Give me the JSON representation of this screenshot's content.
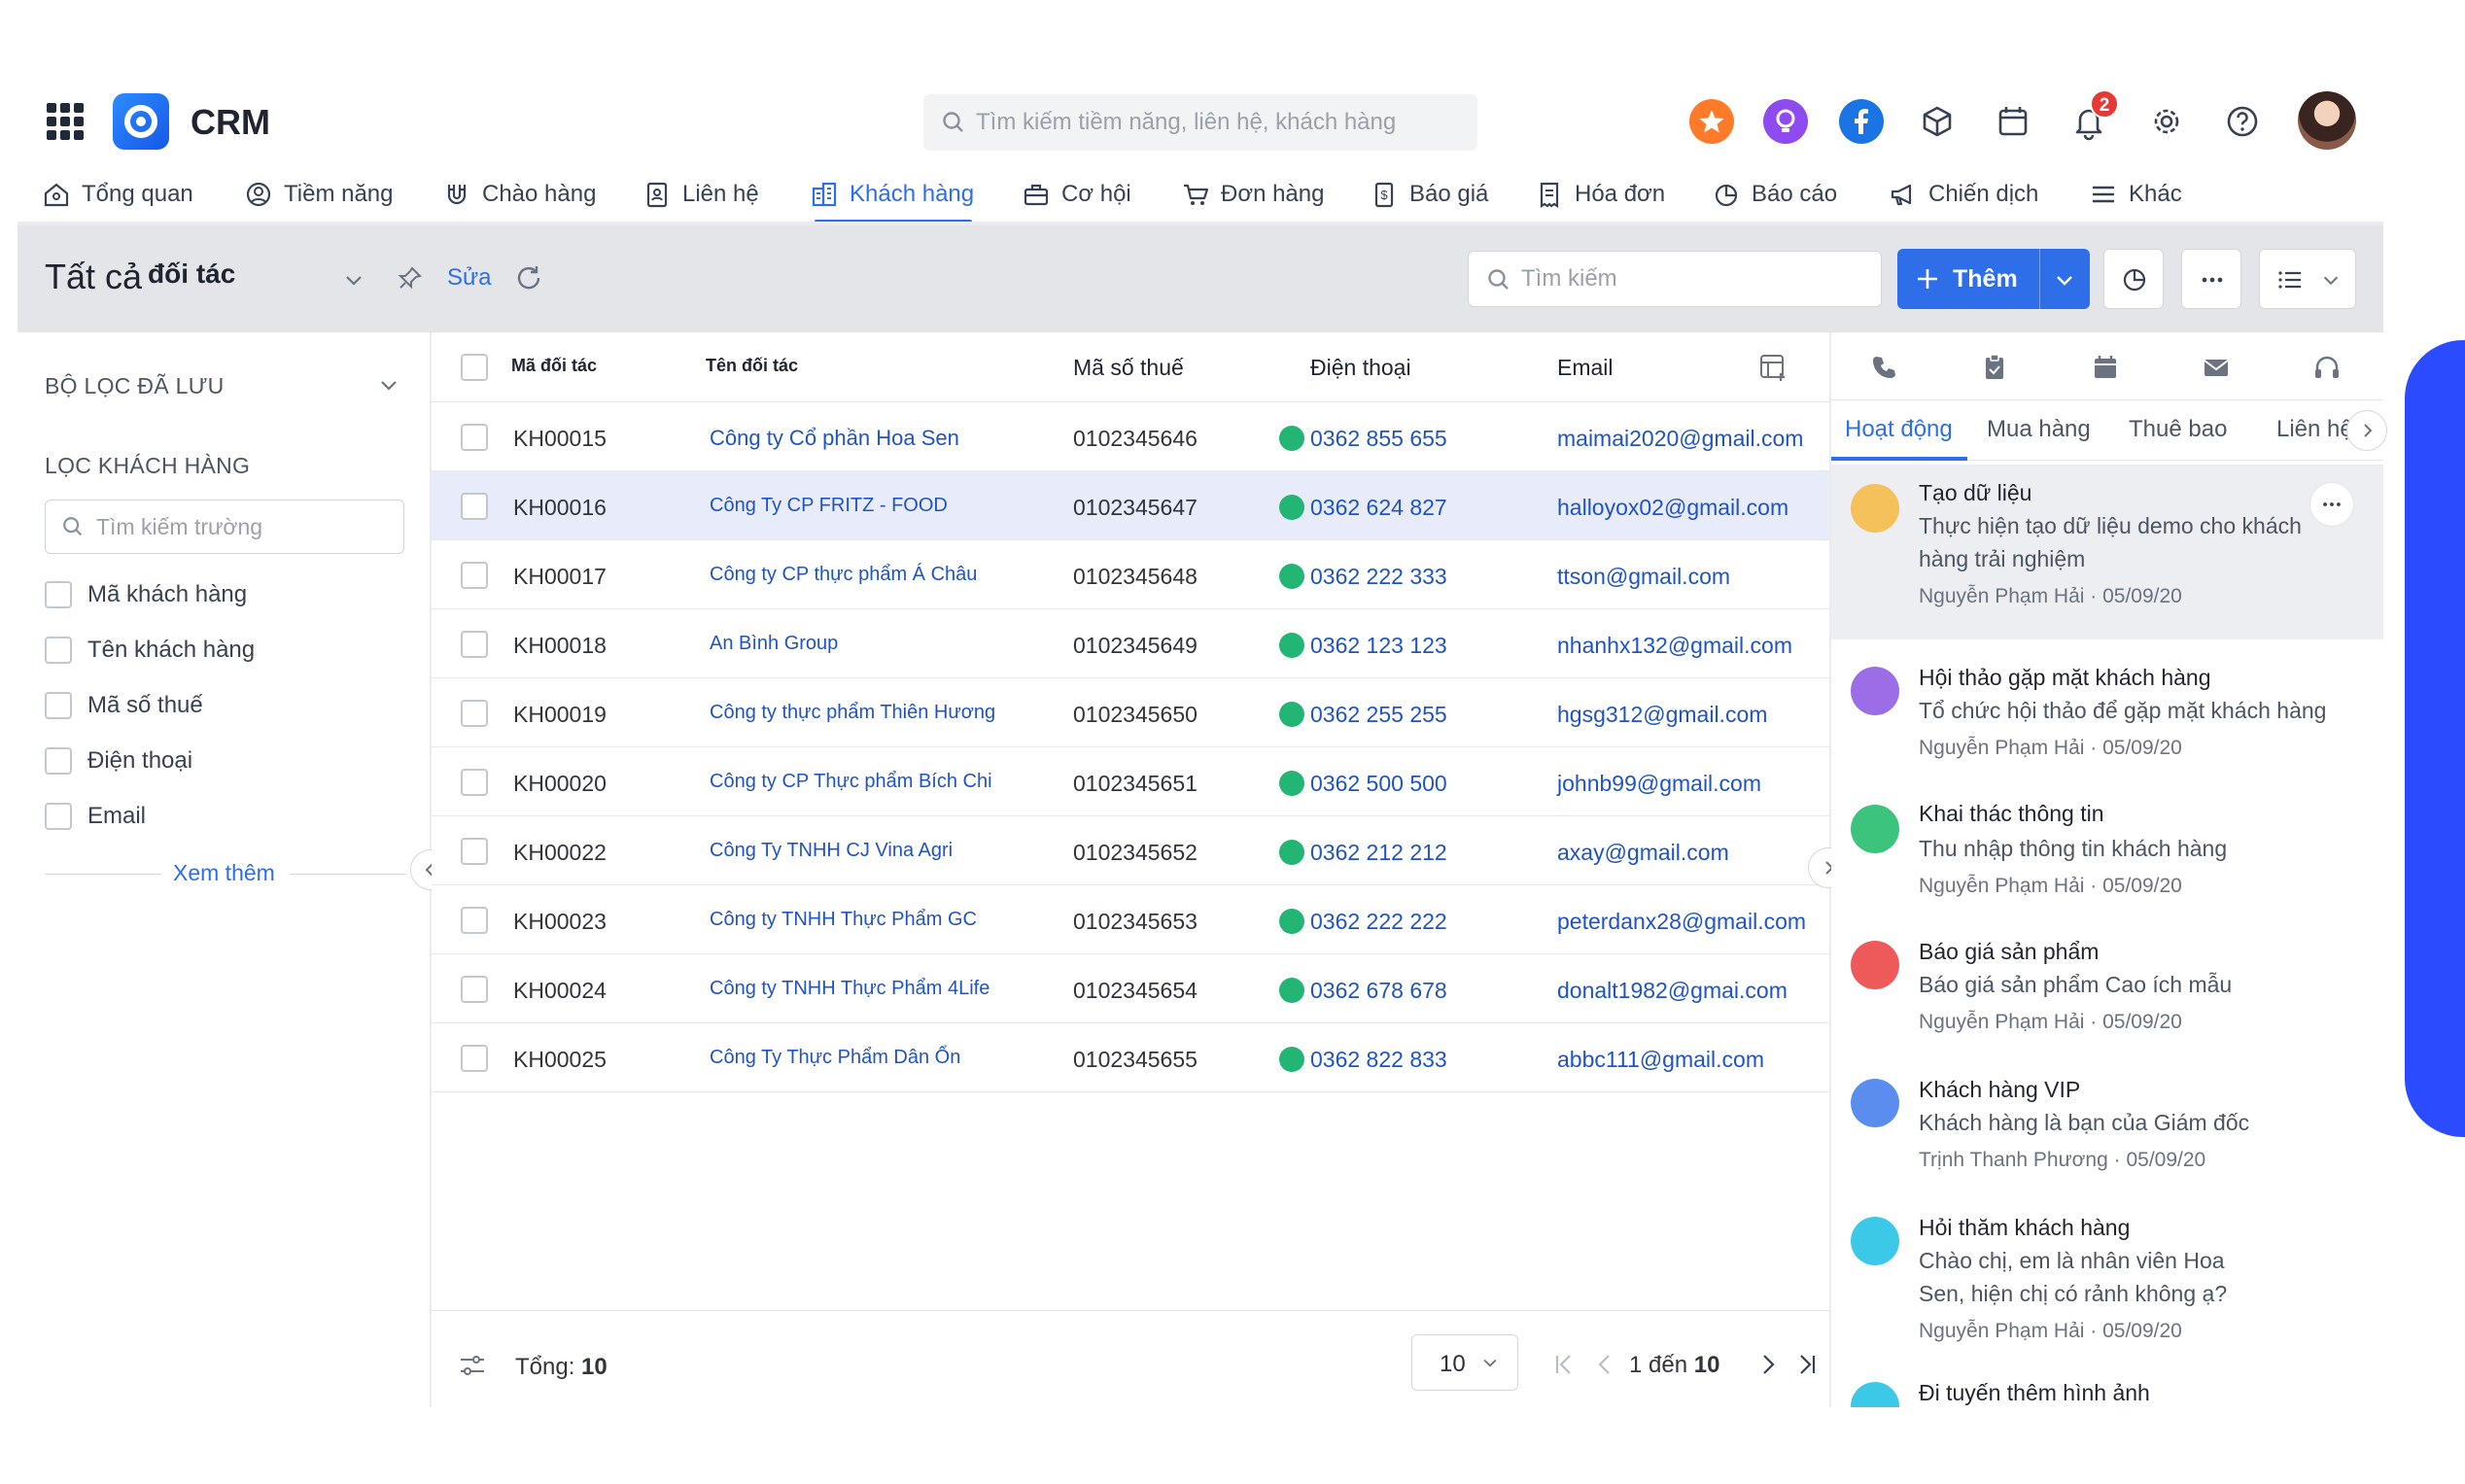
{
  "app": {
    "name": "CRM",
    "search_placeholder": "Tìm kiếm tiềm năng, liên hệ, khách hàng",
    "notification_count": "2"
  },
  "nav": [
    {
      "label": "Tổng quan",
      "icon": "home-icon"
    },
    {
      "label": "Tiềm năng",
      "icon": "lead-icon"
    },
    {
      "label": "Chào hàng",
      "icon": "magnet-icon"
    },
    {
      "label": "Liên hệ",
      "icon": "contact-icon"
    },
    {
      "label": "Khách hàng",
      "icon": "building-icon",
      "active": true
    },
    {
      "label": "Cơ hội",
      "icon": "briefcase-icon"
    },
    {
      "label": "Đơn hàng",
      "icon": "cart-icon"
    },
    {
      "label": "Báo giá",
      "icon": "quote-icon"
    },
    {
      "label": "Hóa đơn",
      "icon": "invoice-icon"
    },
    {
      "label": "Báo cáo",
      "icon": "report-icon"
    },
    {
      "label": "Chiến dịch",
      "icon": "megaphone-icon"
    },
    {
      "label": "Khác",
      "icon": "menu-icon"
    }
  ],
  "toolbar": {
    "view_title": "Tất cả",
    "view_subtitle": "đối tác",
    "edit_label": "Sửa",
    "search_placeholder": "Tìm kiếm",
    "add_label": "Thêm"
  },
  "filters": {
    "saved_title": "BỘ LỌC ĐÃ LƯU",
    "filter_title": "LỌC KHÁCH HÀNG",
    "field_search_placeholder": "Tìm kiếm trường",
    "fields": [
      "Mã khách hàng",
      "Tên khách hàng",
      "Mã số thuế",
      "Điện thoại",
      "Email"
    ],
    "see_more": "Xem thêm"
  },
  "table": {
    "headers": {
      "code": "Mã đối tác",
      "name": "Tên đối tác",
      "tax": "Mã số thuế",
      "phone": "Điện thoại",
      "email": "Email"
    },
    "rows": [
      {
        "code": "KH00015",
        "name": "Công ty Cổ phần Hoa Sen",
        "tax": "0102345646",
        "phone": "0362 855 655",
        "email": "maimai2020@gmail.com"
      },
      {
        "code": "KH00016",
        "name": "Công Ty CP FRITZ - FOOD",
        "tax": "0102345647",
        "phone": "0362 624 827",
        "email": "halloyox02@gmail.com"
      },
      {
        "code": "KH00017",
        "name": "Công ty CP thực phẩm Á Châu",
        "tax": "0102345648",
        "phone": "0362 222 333",
        "email": "ttson@gmail.com"
      },
      {
        "code": "KH00018",
        "name": "An Bình Group",
        "tax": "0102345649",
        "phone": "0362 123 123",
        "email": "nhanhx132@gmail.com"
      },
      {
        "code": "KH00019",
        "name": "Công ty thực phẩm Thiên Hương",
        "tax": "0102345650",
        "phone": "0362 255 255",
        "email": "hgsg312@gmail.com"
      },
      {
        "code": "KH00020",
        "name": "Công ty CP Thực phẩm Bích Chi",
        "tax": "0102345651",
        "phone": "0362 500 500",
        "email": "johnb99@gmail.com"
      },
      {
        "code": "KH00022",
        "name": "Công Ty TNHH CJ Vina Agri",
        "tax": "0102345652",
        "phone": "0362 212 212",
        "email": "axay@gmail.com"
      },
      {
        "code": "KH00023",
        "name": "Công ty TNHH Thực Phẩm GC",
        "tax": "0102345653",
        "phone": "0362 222 222",
        "email": "peterdanx28@gmail.com"
      },
      {
        "code": "KH00024",
        "name": "Công ty TNHH Thực Phẩm 4Life",
        "tax": "0102345654",
        "phone": "0362 678 678",
        "email": "donalt1982@gmai.com"
      },
      {
        "code": "KH00025",
        "name": "Công Ty Thực Phẩm Dân Ổn",
        "tax": "0102345655",
        "phone": "0362 822 833",
        "email": "abbc111@gmail.com"
      }
    ],
    "total_label": "Tổng:",
    "total_value": "10",
    "page_size": "10",
    "range_prefix": "1 đến",
    "range_end": "10"
  },
  "activity": {
    "tabs": [
      "Hoạt động",
      "Mua hàng",
      "Thuê bao",
      "Liên hệ"
    ],
    "items": [
      {
        "title": "Tạo dữ liệu",
        "desc": "Thực hiện tạo dữ liệu demo cho khách hàng trải nghiệm",
        "author": "Nguyễn Phạm Hải",
        "date": "05/09/20",
        "color": "#f5c15a"
      },
      {
        "title": "Hội thảo gặp mặt khách hàng",
        "desc": "Tổ chức hội thảo để gặp mặt khách hàng",
        "author": "Nguyễn Phạm Hải",
        "date": "05/09/20",
        "color": "#9b6ee8"
      },
      {
        "title": "Khai thác thông tin",
        "desc": "Thu nhập thông tin khách hàng",
        "author": "Nguyễn Phạm Hải",
        "date": "05/09/20",
        "color": "#3cc47c"
      },
      {
        "title": "Báo giá sản phẩm",
        "desc": "Báo giá sản phẩm Cao ích mẫu",
        "author": "Nguyễn Phạm Hải",
        "date": "05/09/20",
        "color": "#ee5a5a"
      },
      {
        "title": "Khách hàng VIP",
        "desc": "Khách hàng là bạn của Giám đốc",
        "author": "Trịnh Thanh Phương",
        "date": "05/09/20",
        "color": "#5b8def"
      },
      {
        "title": "Hỏi thăm khách hàng",
        "desc": "Chào chị, em là nhân viên Hoa Sen, hiện chị có rảnh không ạ?",
        "author": "Nguyễn Phạm Hải",
        "date": "05/09/20",
        "color": "#3cc9e8"
      },
      {
        "title": "Đi tuyến thêm hình ảnh",
        "desc": "",
        "author": "",
        "date": "",
        "color": "#3cc9e8"
      }
    ],
    "meta_separator": "·"
  }
}
